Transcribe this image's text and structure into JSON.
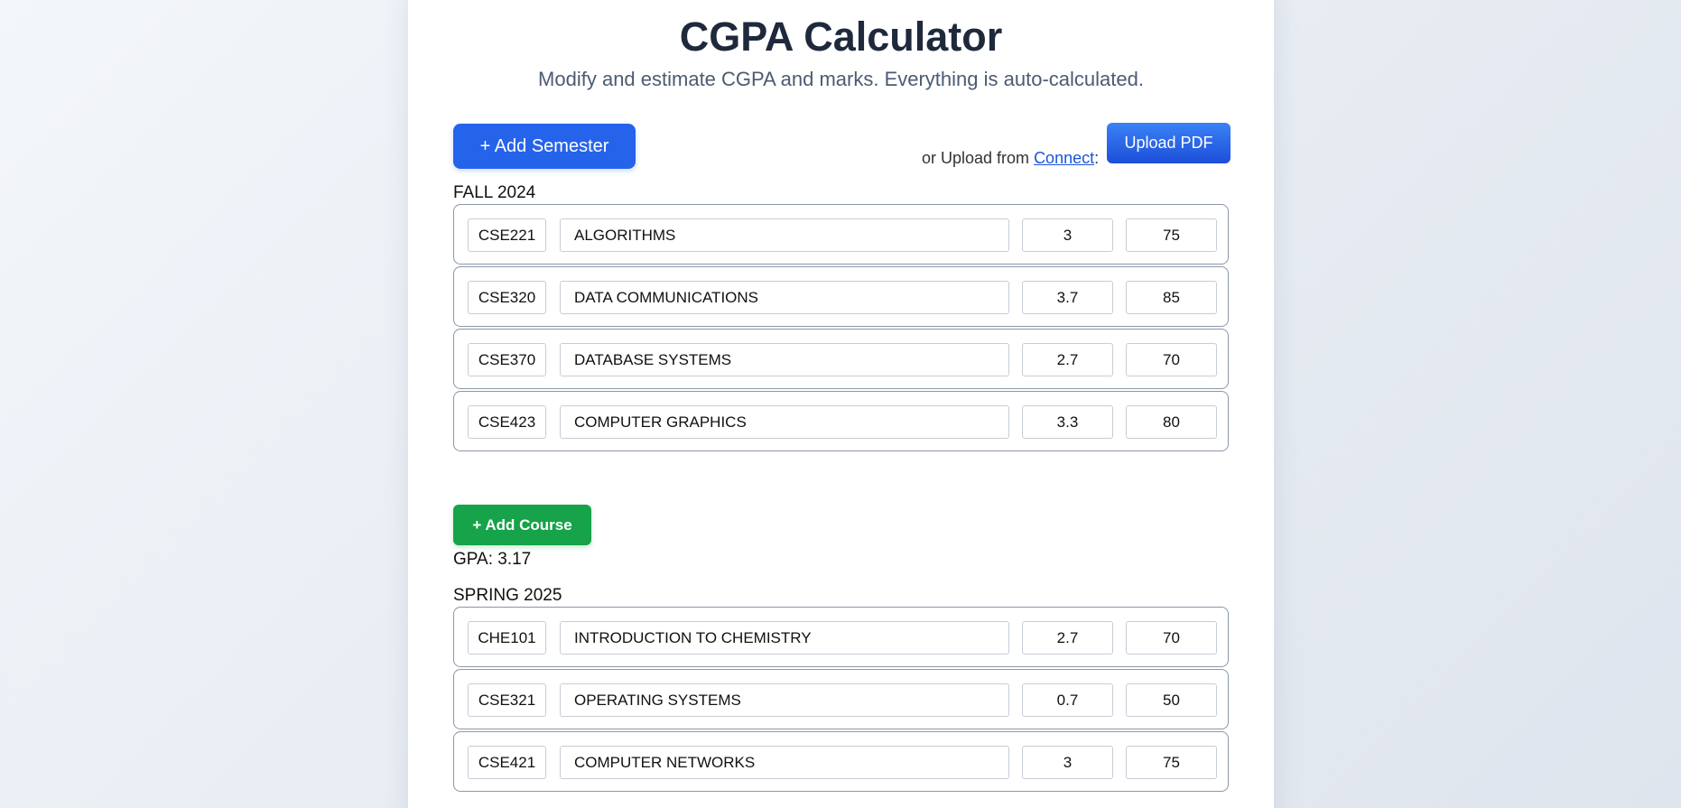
{
  "header": {
    "title": "CGPA Calculator",
    "subtitle": "Modify and estimate CGPA and marks. Everything is auto-calculated."
  },
  "toolbar": {
    "add_semester_label": "+ Add Semester",
    "upload_prefix": "or Upload from ",
    "upload_link_label": "Connect",
    "upload_suffix": ":",
    "upload_button_label": "Upload PDF"
  },
  "semesters": [
    {
      "title": "FALL 2024",
      "courses": [
        {
          "code": "CSE221",
          "name": "ALGORITHMS",
          "grade_point": "3",
          "marks": "75"
        },
        {
          "code": "CSE320",
          "name": "DATA COMMUNICATIONS",
          "grade_point": "3.7",
          "marks": "85"
        },
        {
          "code": "CSE370",
          "name": "DATABASE SYSTEMS",
          "grade_point": "2.7",
          "marks": "70"
        },
        {
          "code": "CSE423",
          "name": "COMPUTER GRAPHICS",
          "grade_point": "3.3",
          "marks": "80"
        }
      ],
      "add_course_label": "+ Add Course",
      "gpa_text": "GPA: 3.17"
    },
    {
      "title": "SPRING 2025",
      "courses": [
        {
          "code": "CHE101",
          "name": "INTRODUCTION TO CHEMISTRY",
          "grade_point": "2.7",
          "marks": "70"
        },
        {
          "code": "CSE321",
          "name": "OPERATING SYSTEMS",
          "grade_point": "0.7",
          "marks": "50"
        },
        {
          "code": "CSE421",
          "name": "COMPUTER NETWORKS",
          "grade_point": "3",
          "marks": "75"
        }
      ]
    }
  ],
  "colors": {
    "primary": "#2563eb",
    "success": "#16a34a",
    "link": "#1a56db"
  }
}
